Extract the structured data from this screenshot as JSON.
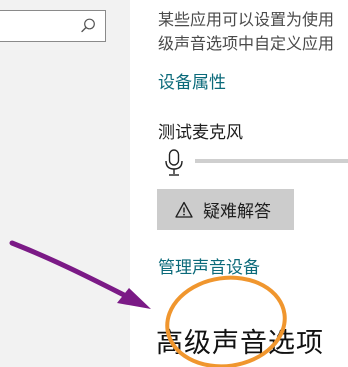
{
  "search": {
    "value": "",
    "placeholder": "",
    "icon": "search-icon"
  },
  "description": {
    "line1": "某些应用可以设置为使用",
    "line2": "级声音选项中自定义应用"
  },
  "links": {
    "device_properties": "设备属性",
    "manage_sound_devices": "管理声音设备"
  },
  "microphone": {
    "title": "测试麦克风",
    "icon": "microphone-icon",
    "level": 0
  },
  "troubleshoot": {
    "label": "疑难解答",
    "icon": "warning-icon"
  },
  "advanced": {
    "title": "高级声音选项"
  },
  "annotations": {
    "arrow_color": "#7b1a86",
    "circle_color": "#f0962e"
  },
  "colors": {
    "link": "#0b6a7a",
    "button_bg": "#cccccc",
    "accent": "#0078d7"
  }
}
